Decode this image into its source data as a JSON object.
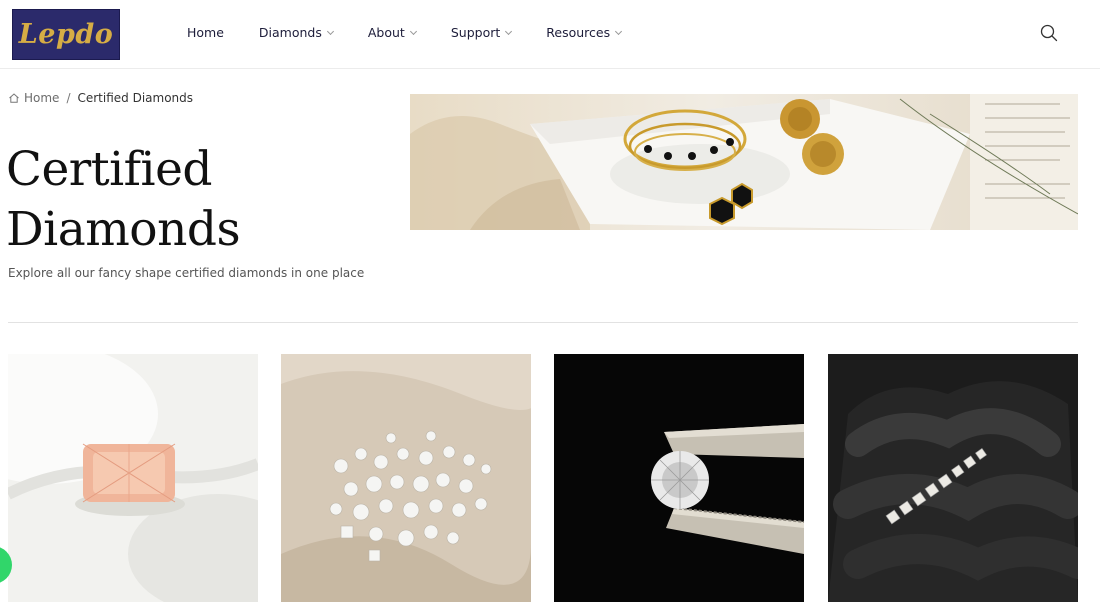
{
  "header": {
    "logo_text": "Lepdo",
    "nav": [
      {
        "label": "Home",
        "has_dropdown": false
      },
      {
        "label": "Diamonds",
        "has_dropdown": true
      },
      {
        "label": "About",
        "has_dropdown": true
      },
      {
        "label": "Support",
        "has_dropdown": true
      },
      {
        "label": "Resources",
        "has_dropdown": true
      }
    ],
    "search_icon": "search-icon"
  },
  "breadcrumb": {
    "home_label": "Home",
    "separator": "/",
    "current": "Certified Diamonds"
  },
  "page": {
    "title": "Certified Diamonds",
    "subtitle": "Explore all our fancy shape certified diamonds in one place"
  },
  "hero": {
    "alt": "gold jewelry with black stones on white plate"
  },
  "cards": [
    {
      "alt": "pink radiant cut diamond on white fabric"
    },
    {
      "alt": "loose diamonds scattered on beige fabric"
    },
    {
      "alt": "round brilliant diamond held by tweezers"
    },
    {
      "alt": "diamond tennis bracelet on black glove"
    }
  ],
  "colors": {
    "brand_navy": "#2b2a6b",
    "brand_gold": "#d6ad45",
    "chat_green": "#31d66a"
  }
}
